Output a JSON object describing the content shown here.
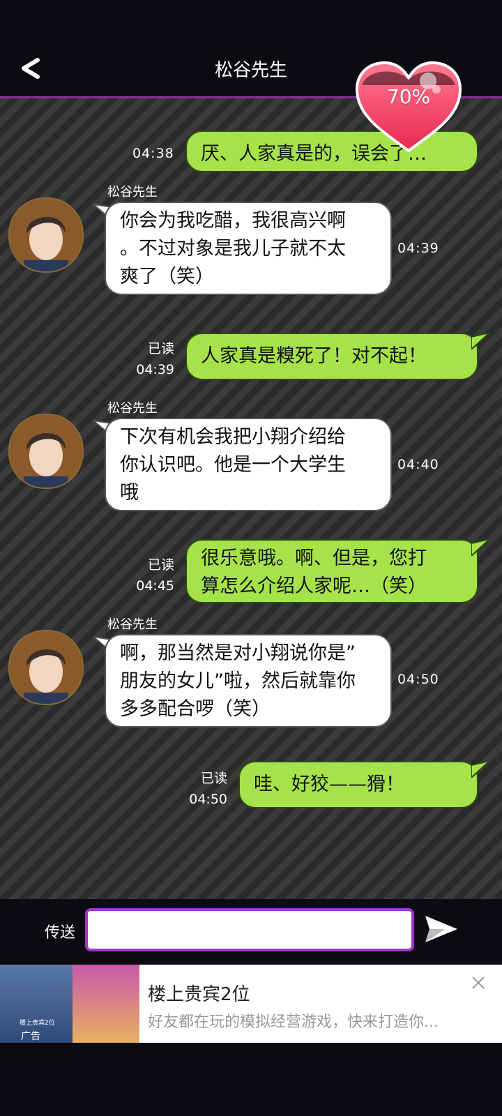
{
  "header": {
    "title": "松谷先生",
    "back_icon": "back-chevron-icon"
  },
  "affection": {
    "percent_label": "70%",
    "value": 0.7,
    "color": "#f0426a"
  },
  "messages": [
    {
      "from": "me",
      "text": "厌、人家真是的，误会了…",
      "time": "04:38",
      "read": ""
    },
    {
      "from": "them",
      "sender": "松谷先生",
      "line1": "你会为我吃醋，我很高兴啊",
      "line2": "。不过对象是我儿子就不太",
      "line3": "爽了（笑）",
      "time": "04:39"
    },
    {
      "from": "me",
      "text": "人家真是糗死了！对不起！",
      "time": "04:39",
      "read": "已读"
    },
    {
      "from": "them",
      "sender": "松谷先生",
      "line1": "下次有机会我把小翔介绍给",
      "line2": "你认识吧。他是一个大学生",
      "line3": "哦",
      "time": "04:40"
    },
    {
      "from": "me",
      "line1": "很乐意哦。啊、但是，您打",
      "line2": "算怎么介绍人家呢…（笑）",
      "time": "04:45",
      "read": "已读"
    },
    {
      "from": "them",
      "sender": "松谷先生",
      "line1": "啊，那当然是对小翔说你是”",
      "line2": "朋友的女儿”啦，然后就靠你",
      "line3": "多多配合啰（笑）",
      "time": "04:50"
    },
    {
      "from": "me",
      "text": "哇、好狡——猾！",
      "time": "04:50",
      "read": "已读"
    }
  ],
  "input": {
    "label": "传送",
    "value": "",
    "placeholder": ""
  },
  "ad": {
    "title": "楼上贵宾2位",
    "description": "好友都在玩的模拟经营游戏，快来打造你...",
    "tag": "广告",
    "mini_caption": "楼上贵宾2位"
  },
  "colors": {
    "my_bubble": "#a6e34a",
    "their_bubble": "#ffffff",
    "accent": "#a336c9"
  }
}
